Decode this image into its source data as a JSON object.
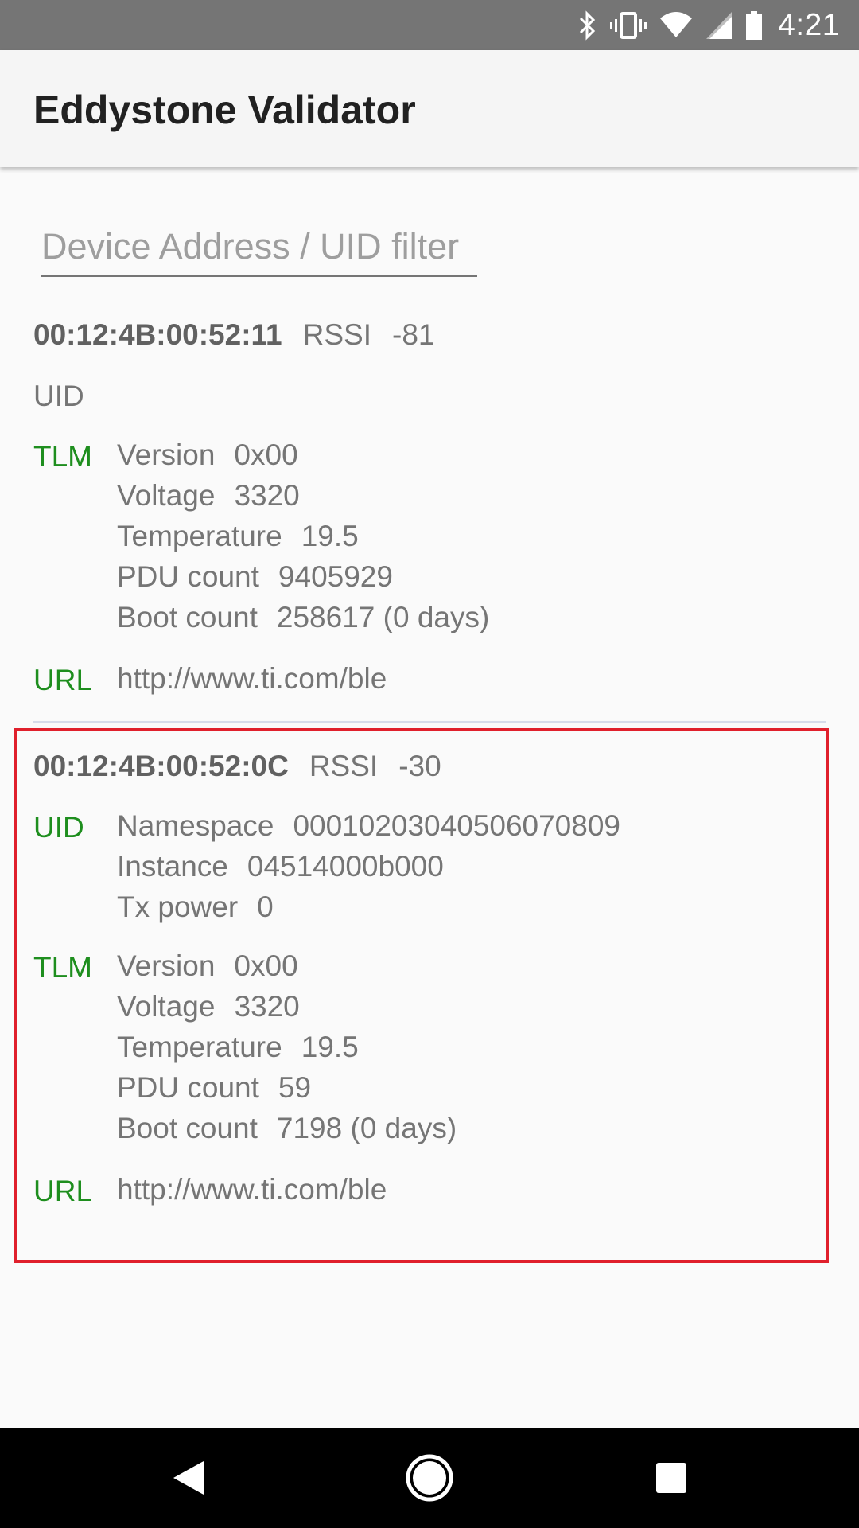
{
  "status_bar": {
    "time": "4:21",
    "icons": [
      "bluetooth-icon",
      "vibrate-icon",
      "wifi-icon",
      "signal-icon",
      "battery-icon"
    ]
  },
  "app_bar": {
    "title": "Eddystone Validator"
  },
  "filter": {
    "placeholder": "Device Address / UID filter",
    "value": ""
  },
  "beacons": [
    {
      "address": "00:12:4B:00:52:11",
      "rssi_label": "RSSI",
      "rssi": "-81",
      "uid": {
        "label": "UID",
        "lines": []
      },
      "tlm": {
        "label": "TLM",
        "lines": [
          {
            "key": "Version",
            "value": "0x00"
          },
          {
            "key": "Voltage",
            "value": "3320"
          },
          {
            "key": "Temperature",
            "value": "19.5"
          },
          {
            "key": "PDU count",
            "value": "9405929"
          },
          {
            "key": "Boot count",
            "value": "258617 (0 days)"
          }
        ]
      },
      "url": {
        "label": "URL",
        "value": "http://www.ti.com/ble"
      }
    },
    {
      "address": "00:12:4B:00:52:0C",
      "rssi_label": "RSSI",
      "rssi": "-30",
      "uid": {
        "label": "UID",
        "lines": [
          {
            "key": "Namespace",
            "value": "00010203040506070809"
          },
          {
            "key": "Instance",
            "value": "04514000b000"
          },
          {
            "key": "Tx power",
            "value": "0"
          }
        ]
      },
      "tlm": {
        "label": "TLM",
        "lines": [
          {
            "key": "Version",
            "value": "0x00"
          },
          {
            "key": "Voltage",
            "value": "3320"
          },
          {
            "key": "Temperature",
            "value": "19.5"
          },
          {
            "key": "PDU count",
            "value": "59"
          },
          {
            "key": "Boot count",
            "value": "7198 (0 days)"
          }
        ]
      },
      "url": {
        "label": "URL",
        "value": "http://www.ti.com/ble"
      }
    }
  ],
  "colors": {
    "frame_active": "#1e8e1e",
    "highlight": "#e0202c",
    "status_bar": "#757575",
    "nav_bar": "#000000"
  },
  "nav": {
    "buttons": [
      "back-icon",
      "home-icon",
      "recents-icon"
    ]
  }
}
